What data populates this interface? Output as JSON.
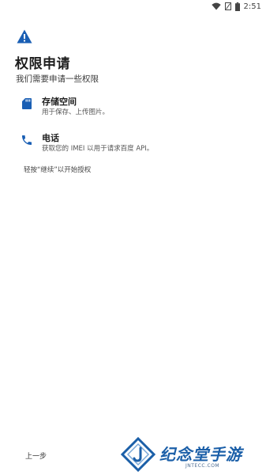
{
  "status_bar": {
    "time": "2:51",
    "icons": [
      "wifi-icon",
      "battery-saver-icon",
      "battery-icon"
    ]
  },
  "header": {
    "icon": "warning-icon",
    "title": "权限申请",
    "subtitle": "我们需要申请一些权限"
  },
  "permissions": [
    {
      "icon": "sd-card-icon",
      "title": "存储空间",
      "description": "用于保存、上传图片。"
    },
    {
      "icon": "phone-icon",
      "title": "电话",
      "description": "获取您的 IMEI 以用于请求百度 API。"
    }
  ],
  "hint": "轻按“继续”以开始授权",
  "footer": {
    "back_label": "上一步"
  },
  "watermark": {
    "name": "纪念堂手游",
    "url": "JNTECC.COM"
  },
  "colors": {
    "icon": "#1a5fb4",
    "watermark": "#1b5fa8"
  }
}
